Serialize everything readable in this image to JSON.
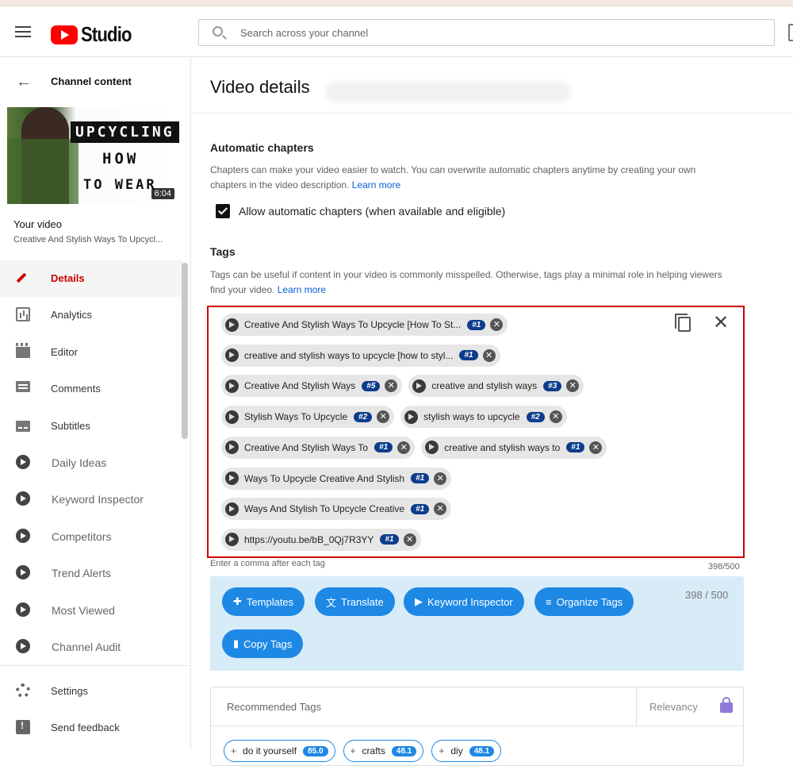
{
  "app": {
    "name": "Studio"
  },
  "search": {
    "placeholder": "Search across your channel"
  },
  "sidebar": {
    "back_label": "Channel content",
    "thumbnail": {
      "line1": "UPCYCLING",
      "line2": "HOW",
      "line3": "TO WEAR",
      "duration": "6:04"
    },
    "your_video_label": "Your video",
    "video_title": "Creative And Stylish Ways To Upcycl...",
    "items": [
      {
        "label": "Details",
        "icon": "pencil-icon",
        "active": true
      },
      {
        "label": "Analytics",
        "icon": "analytics-icon"
      },
      {
        "label": "Editor",
        "icon": "clapperboard-icon"
      },
      {
        "label": "Comments",
        "icon": "comment-icon"
      },
      {
        "label": "Subtitles",
        "icon": "subtitles-icon"
      },
      {
        "label": "Daily Ideas",
        "icon": "extension-logo-icon"
      },
      {
        "label": "Keyword Inspector",
        "icon": "extension-logo-icon"
      },
      {
        "label": "Competitors",
        "icon": "extension-logo-icon"
      },
      {
        "label": "Trend Alerts",
        "icon": "extension-logo-icon"
      },
      {
        "label": "Most Viewed",
        "icon": "extension-logo-icon"
      },
      {
        "label": "Channel Audit",
        "icon": "extension-logo-icon"
      }
    ],
    "bottom_items": [
      {
        "label": "Settings",
        "icon": "gear-icon"
      },
      {
        "label": "Send feedback",
        "icon": "feedback-icon"
      }
    ]
  },
  "main": {
    "title": "Video details",
    "chapters": {
      "heading": "Automatic chapters",
      "description": "Chapters can make your video easier to watch. You can overwrite automatic chapters anytime by creating your own chapters in the video description.",
      "learn_more": "Learn more",
      "checkbox_label": "Allow automatic chapters (when available and eligible)",
      "checked": true
    },
    "tags": {
      "heading": "Tags",
      "description": "Tags can be useful if content in your video is commonly misspelled. Otherwise, tags play a minimal role in helping viewers find your video.",
      "learn_more": "Learn more",
      "rows": [
        [
          {
            "text": "Creative And Stylish Ways To Upcycle [How To St...",
            "rank": "#1"
          }
        ],
        [
          {
            "text": "creative and stylish ways to upcycle [how to styl...",
            "rank": "#1"
          }
        ],
        [
          {
            "text": "Creative And Stylish Ways",
            "rank": "#5"
          },
          {
            "text": "creative and stylish ways",
            "rank": "#3"
          }
        ],
        [
          {
            "text": "Stylish Ways To Upcycle",
            "rank": "#2"
          },
          {
            "text": "stylish ways to upcycle",
            "rank": "#2"
          }
        ],
        [
          {
            "text": "Creative And Stylish Ways To",
            "rank": "#1"
          },
          {
            "text": "creative and stylish ways to",
            "rank": "#1"
          }
        ],
        [
          {
            "text": "Ways To Upcycle Creative And Stylish",
            "rank": "#1"
          }
        ],
        [
          {
            "text": "Ways And Stylish To Upcycle Creative",
            "rank": "#1"
          }
        ],
        [
          {
            "text": "https://youtu.be/bB_0Qj7R3YY",
            "rank": "#1"
          }
        ]
      ],
      "hint": "Enter a comma after each tag",
      "count": "398/500"
    },
    "tools": {
      "buttons": [
        "Templates",
        "Translate",
        "Keyword Inspector",
        "Organize Tags",
        "Copy Tags"
      ],
      "count": "398 / 500",
      "accent": "#1e88e5",
      "background": "#d7ecf7"
    },
    "recommended": {
      "heading": "Recommended Tags",
      "sort_label": "Relevancy",
      "chips": [
        {
          "text": "do it yourself",
          "score": "85.0"
        },
        {
          "text": "crafts",
          "score": "48.1"
        },
        {
          "text": "diy",
          "score": "48.1"
        }
      ]
    }
  },
  "colors": {
    "brand_red": "#ff0000",
    "active_red": "#cc0000",
    "highlight_border": "#d10000",
    "rank_badge": "#0d3c8c",
    "link": "#065fd4"
  }
}
